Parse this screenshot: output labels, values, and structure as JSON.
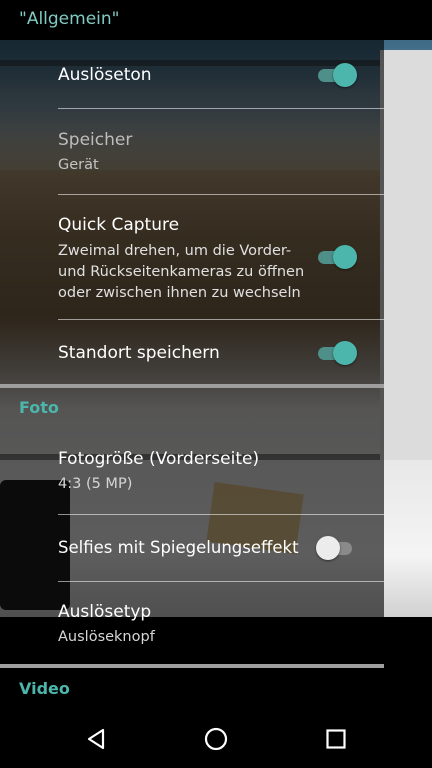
{
  "header": {
    "title": "\"Allgemein\""
  },
  "settings": {
    "shutter_sound": {
      "title": "Auslöseton",
      "enabled": true
    },
    "storage": {
      "title": "Speicher",
      "value": "Gerät"
    },
    "quick_capture": {
      "title": "Quick Capture",
      "description": "Zweimal drehen, um die Vorder- und Rückseitenkameras zu öffnen oder zwischen ihnen zu wechseln",
      "enabled": true
    },
    "save_location": {
      "title": "Standort speichern",
      "enabled": true
    }
  },
  "photo": {
    "section_label": "Foto",
    "photo_size": {
      "title": "Fotogröße (Vorderseite)",
      "value": "4:3 (5 MP)"
    },
    "mirror_selfies": {
      "title": "Selfies mit Spiegelungseffekt",
      "enabled": false
    },
    "shutter_type": {
      "title": "Auslösetyp",
      "value": "Auslöseknopf"
    }
  },
  "video": {
    "section_label": "Video"
  },
  "colors": {
    "accent": "#4db6ac",
    "accent_dark": "#4f8f89",
    "background": "#000000"
  },
  "navbar": {
    "icons": [
      "back-icon",
      "home-icon",
      "recents-icon"
    ]
  }
}
